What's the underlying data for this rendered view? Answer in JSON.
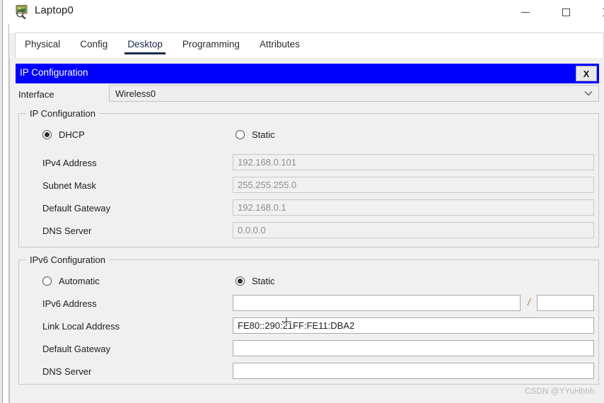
{
  "window": {
    "title": "Laptop0",
    "icon": "laptop-magnifier-icon",
    "controls": {
      "minimize_label": "—",
      "maximize_label": "□",
      "close_label": "×"
    }
  },
  "tabs": [
    {
      "label": "Physical",
      "active": false
    },
    {
      "label": "Config",
      "active": false
    },
    {
      "label": "Desktop",
      "active": true
    },
    {
      "label": "Programming",
      "active": false
    },
    {
      "label": "Attributes",
      "active": false
    }
  ],
  "dialog": {
    "title": "IP Configuration",
    "close_label": "X",
    "accent_color": "#0000ff",
    "interface": {
      "label": "Interface",
      "value": "Wireless0",
      "chevron": "∨"
    },
    "ipv4": {
      "group_title": "IP Configuration",
      "mode_options": [
        {
          "label": "DHCP",
          "selected": true
        },
        {
          "label": "Static",
          "selected": false
        }
      ],
      "fields": [
        {
          "label": "IPv4 Address",
          "value": "192.168.0.101",
          "disabled": true
        },
        {
          "label": "Subnet Mask",
          "value": "255.255.255.0",
          "disabled": true
        },
        {
          "label": "Default Gateway",
          "value": "192.168.0.1",
          "disabled": true
        },
        {
          "label": "DNS Server",
          "value": "0.0.0.0",
          "disabled": true
        }
      ]
    },
    "ipv6": {
      "group_title": "IPv6 Configuration",
      "mode_options": [
        {
          "label": "Automatic",
          "selected": false
        },
        {
          "label": "Static",
          "selected": true
        }
      ],
      "address_row": {
        "label": "IPv6 Address",
        "value": "",
        "separator": "/",
        "prefix_value": ""
      },
      "fields": [
        {
          "label": "Link Local Address",
          "value": "FE80::290:21FF:FE11:DBA2",
          "disabled": false
        },
        {
          "label": "Default Gateway",
          "value": "",
          "disabled": false
        },
        {
          "label": "DNS Server",
          "value": "",
          "disabled": false
        }
      ]
    }
  },
  "watermark": "CSDN @YYuHhhh"
}
